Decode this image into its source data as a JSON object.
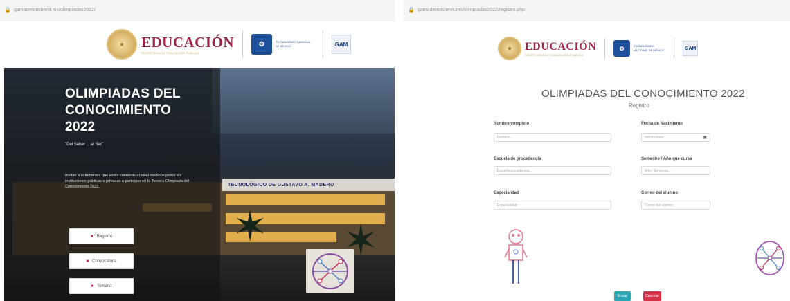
{
  "left": {
    "url": "gamaderoitsbenit.mx/olimpiadas2022/",
    "logo": {
      "edu": "EDUCACIÓN",
      "edu_sub": "SECRETARÍA DE EDUCACIÓN PÚBLICA",
      "tecnm_text": "TECNOLÓGICO NACIONAL DE MÉXICO",
      "gam": "GAM"
    },
    "hero": {
      "title": "OLIMPIADAS DEL\nCONOCIMIENTO\n2022",
      "slogan": "\"Del Saber ....al Ser\"",
      "description": "Invitan a estudiantes que estén cursando el nivel medio superior en instituciones públicas o privadas a participar en la Tercera Olimpiada del Conocimiento 2022.",
      "building_sign": "TECNOLÓGICO DE GUSTAVO A. MADERO"
    },
    "buttons": [
      "Registro",
      "Convocatoria",
      "Temario"
    ]
  },
  "right": {
    "url": "gamaderoitsbenit.mx/olimpiadas2022/registro.php",
    "logo": {
      "edu": "EDUCACIÓN",
      "edu_sub": "SECRETARÍA DE EDUCACIÓN PÚBLICA",
      "tecnm_text": "TECNOLÓGICO NACIONAL DE MÉXICO",
      "gam": "GAM"
    },
    "title": "OLIMPIADAS DEL CONOCIMIENTO 2022",
    "subtitle": "Registro",
    "fields": {
      "nombre": {
        "label": "Nombre completo",
        "placeholder": "Nombre..."
      },
      "fecha": {
        "label": "Fecha de Nacimiento",
        "placeholder": "dd/mm/aaaa"
      },
      "escuela": {
        "label": "Escuela de procedencia",
        "placeholder": "Escuela procedencia..."
      },
      "semestre": {
        "label": "Semestre / Año que cursa",
        "placeholder": "Año / Semestre..."
      },
      "especialidad": {
        "label": "Especialidad",
        "placeholder": "Especialidad..."
      },
      "correo": {
        "label": "Correo del alumno",
        "placeholder": "Correo del alumno..."
      }
    },
    "buttons": {
      "send": "Enviar",
      "cancel": "Cancelar"
    }
  },
  "colors": {
    "brand": "#9d2449",
    "tecnm": "#1e4f9a",
    "send": "#2aa6b4",
    "cancel": "#d6334b"
  }
}
